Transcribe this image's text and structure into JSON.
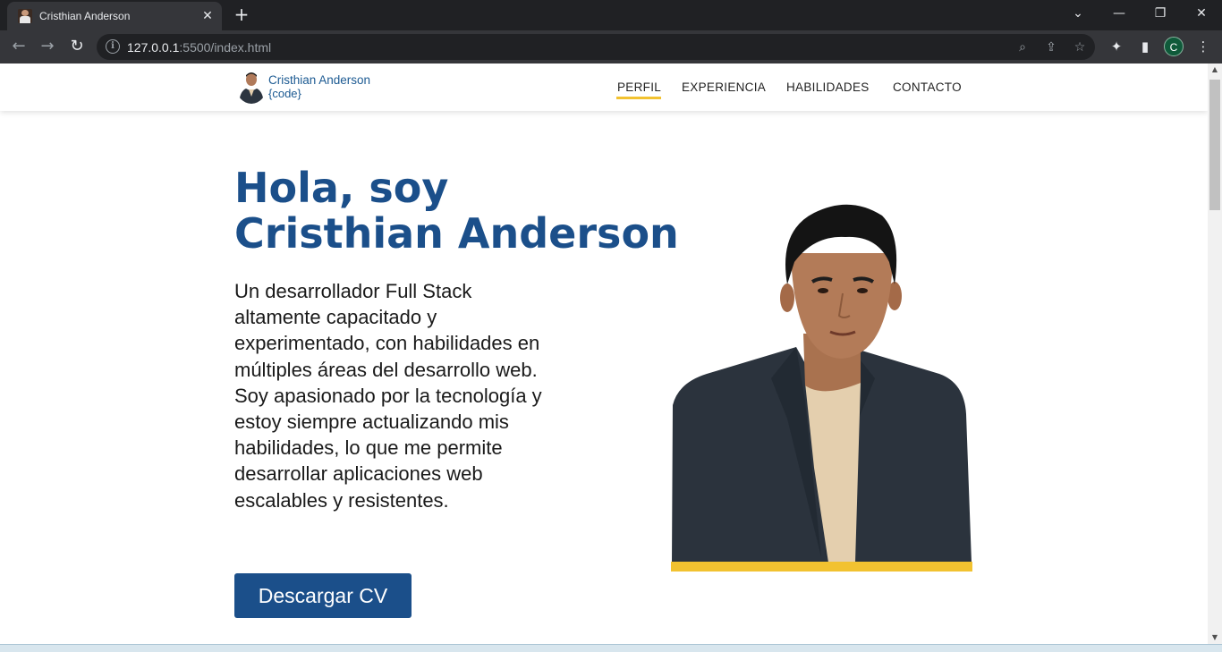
{
  "browser": {
    "tab_title": "Cristhian Anderson",
    "url_host": "127.0.0.1",
    "url_path": ":5500/index.html",
    "profile_initial": "C"
  },
  "site": {
    "logo": {
      "name": "Cristhian Anderson",
      "tagline": "{code}"
    },
    "nav": {
      "items": [
        "PERFIL",
        "EXPERIENCIA",
        "HABILIDADES",
        "CONTACTO"
      ],
      "active": "PERFIL"
    },
    "hero": {
      "title_line1": "Hola, soy",
      "title_line2": "Cristhian Anderson",
      "description": "Un desarrollador Full Stack altamente capacitado y experimentado, con habilidades en múltiples áreas del desarrollo web. Soy apasionado por la tecnología y estoy siempre actualizando mis habilidades, lo que me permite desarrollar aplicaciones web escalables y resistentes.",
      "cta_label": "Descargar CV"
    }
  },
  "colors": {
    "brand_blue": "#1b4f8a",
    "accent_yellow": "#f2c230"
  },
  "icons": {
    "back": "arrow-left-icon",
    "forward": "arrow-right-icon",
    "reload": "reload-icon",
    "info": "info-icon",
    "zoom": "zoom-icon",
    "share": "share-icon",
    "bookmark": "star-icon",
    "extensions": "puzzle-icon",
    "sidepanel": "side-panel-icon",
    "menu": "kebab-menu-icon"
  }
}
